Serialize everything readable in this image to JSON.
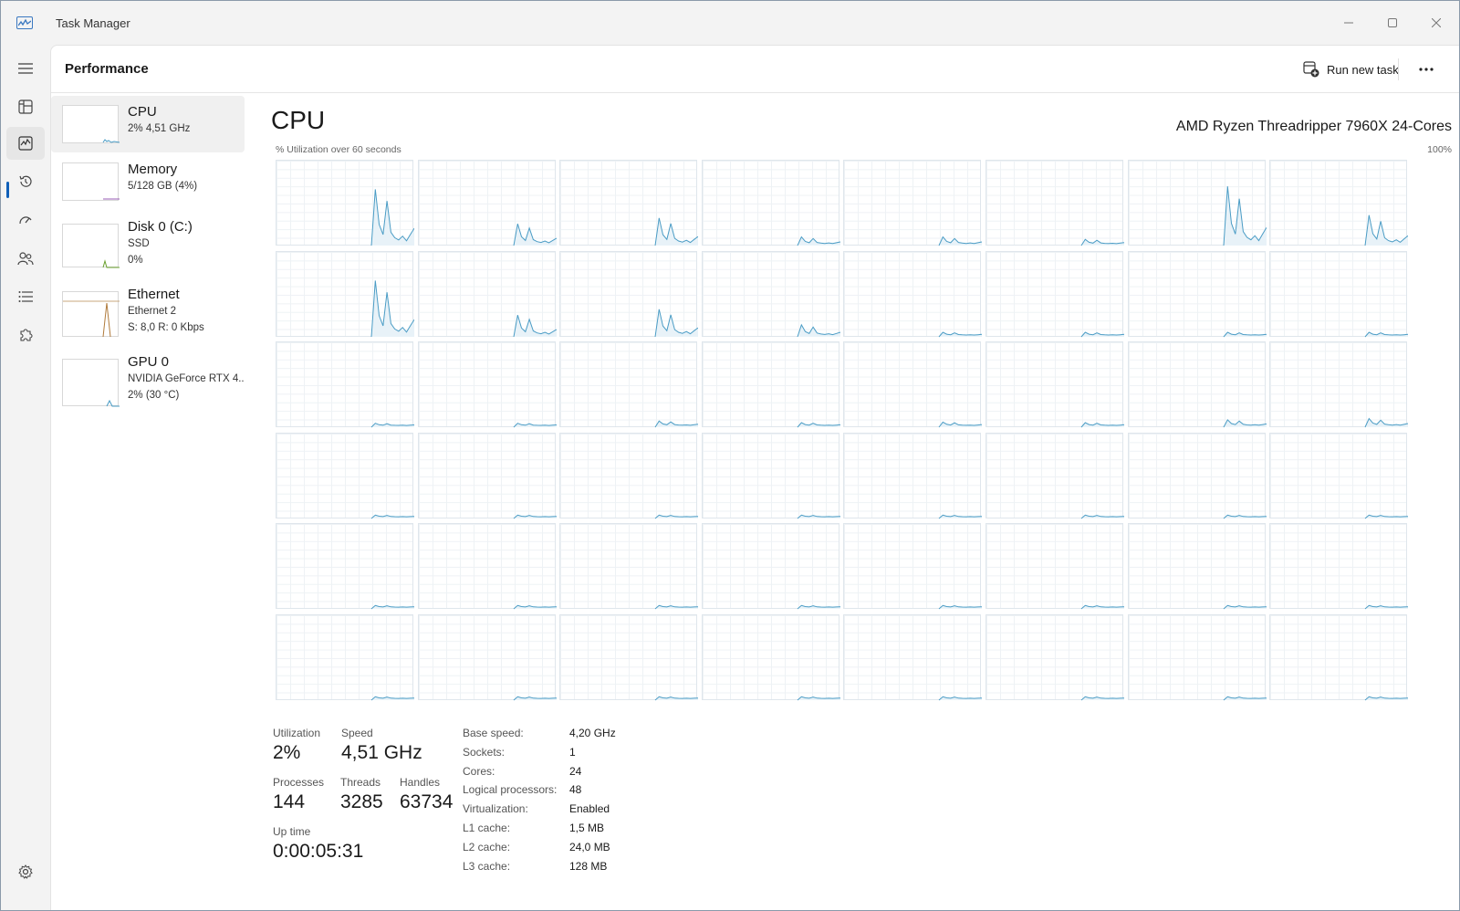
{
  "window": {
    "title": "Task Manager"
  },
  "header": {
    "page_title": "Performance",
    "run_new_task": "Run new task"
  },
  "devices": [
    {
      "name": "CPU",
      "lines": [
        "2%  4,51 GHz"
      ]
    },
    {
      "name": "Memory",
      "lines": [
        "5/128 GB (4%)"
      ]
    },
    {
      "name": "Disk 0 (C:)",
      "lines": [
        "SSD",
        "0%"
      ]
    },
    {
      "name": "Ethernet",
      "lines": [
        "Ethernet 2",
        "S: 8,0  R: 0 Kbps"
      ]
    },
    {
      "name": "GPU 0",
      "lines": [
        "NVIDIA GeForce RTX 4..",
        "2%  (30 °C)"
      ]
    }
  ],
  "cpu": {
    "title": "CPU",
    "model": "AMD Ryzen Threadripper 7960X 24-Cores",
    "axis_caption": "% Utilization over 60 seconds",
    "axis_max": "100%",
    "logical_processors_graphs": 48
  },
  "stats": {
    "utilization_label": "Utilization",
    "utilization": "2%",
    "speed_label": "Speed",
    "speed": "4,51 GHz",
    "processes_label": "Processes",
    "processes": "144",
    "threads_label": "Threads",
    "threads": "3285",
    "handles_label": "Handles",
    "handles": "63734",
    "uptime_label": "Up time",
    "uptime": "0:00:05:31"
  },
  "specs": [
    {
      "k": "Base speed:",
      "v": "4,20 GHz"
    },
    {
      "k": "Sockets:",
      "v": "1"
    },
    {
      "k": "Cores:",
      "v": "24"
    },
    {
      "k": "Logical processors:",
      "v": "48"
    },
    {
      "k": "Virtualization:",
      "v": "Enabled"
    },
    {
      "k": "L1 cache:",
      "v": "1,5 MB"
    },
    {
      "k": "L2 cache:",
      "v": "24,0 MB"
    },
    {
      "k": "L3 cache:",
      "v": "128 MB"
    }
  ],
  "colors": {
    "cpu_line": "#4a9cc5",
    "mem_line": "#9a5cb4",
    "disk_line": "#6aa02e",
    "eth_line": "#b07a3a",
    "accent": "#0f5fb8"
  }
}
